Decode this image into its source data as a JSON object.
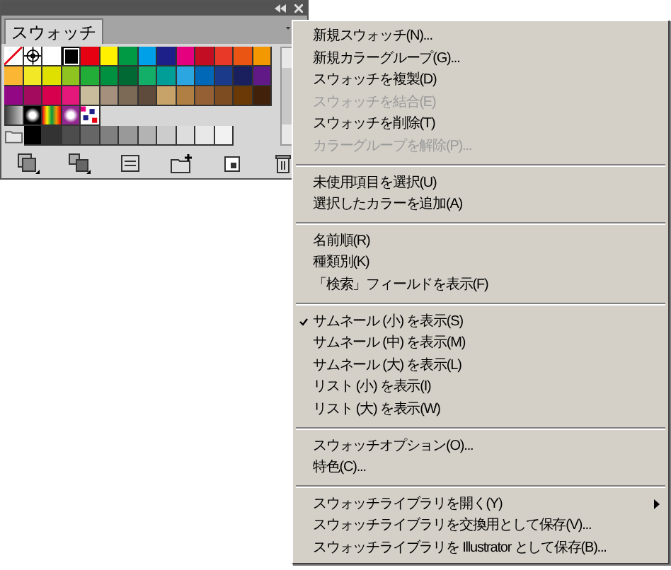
{
  "panel": {
    "tab": {
      "label": "スウォッチ",
      "selected": true
    },
    "swatch_rows": [
      [
        {
          "kind": "none"
        },
        {
          "kind": "registration"
        },
        {
          "kind": "solid",
          "color": "#ffffff"
        },
        {
          "kind": "solid",
          "color": "#000000",
          "selected": true
        },
        {
          "kind": "solid",
          "color": "#e60012"
        },
        {
          "kind": "solid",
          "color": "#fff100"
        },
        {
          "kind": "solid",
          "color": "#009944"
        },
        {
          "kind": "solid",
          "color": "#00a0e9"
        },
        {
          "kind": "solid",
          "color": "#1d2088"
        },
        {
          "kind": "solid",
          "color": "#e4007f"
        },
        {
          "kind": "solid",
          "color": "#c30d23"
        },
        {
          "kind": "solid",
          "color": "#e83828"
        },
        {
          "kind": "solid",
          "color": "#ea5514"
        },
        {
          "kind": "solid",
          "color": "#f39800"
        }
      ],
      [
        {
          "kind": "solid",
          "color": "#fbb634"
        },
        {
          "kind": "solid",
          "color": "#f3e826"
        },
        {
          "kind": "solid",
          "color": "#dfe000"
        },
        {
          "kind": "solid",
          "color": "#8fc31f"
        },
        {
          "kind": "solid",
          "color": "#22ac38"
        },
        {
          "kind": "solid",
          "color": "#009140"
        },
        {
          "kind": "solid",
          "color": "#006934"
        },
        {
          "kind": "solid",
          "color": "#13ae67"
        },
        {
          "kind": "solid",
          "color": "#009e96"
        },
        {
          "kind": "solid",
          "color": "#2ca6e0"
        },
        {
          "kind": "solid",
          "color": "#0068b7"
        },
        {
          "kind": "solid",
          "color": "#1b3a8a"
        },
        {
          "kind": "solid",
          "color": "#1a1f5d"
        },
        {
          "kind": "solid",
          "color": "#601986"
        }
      ],
      [
        {
          "kind": "solid",
          "color": "#920783"
        },
        {
          "kind": "solid",
          "color": "#a20b5e"
        },
        {
          "kind": "solid",
          "color": "#d7004f"
        },
        {
          "kind": "solid",
          "color": "#e4187b"
        },
        {
          "kind": "solid",
          "color": "#c9bc9c"
        },
        {
          "kind": "solid",
          "color": "#a4907c"
        },
        {
          "kind": "solid",
          "color": "#7c6a56"
        },
        {
          "kind": "solid",
          "color": "#5e4b3c"
        },
        {
          "kind": "solid",
          "color": "#c7a269"
        },
        {
          "kind": "solid",
          "color": "#b07f44"
        },
        {
          "kind": "solid",
          "color": "#956134"
        },
        {
          "kind": "solid",
          "color": "#7e4c21"
        },
        {
          "kind": "solid",
          "color": "#6a3906"
        },
        {
          "kind": "solid",
          "color": "#42210b"
        }
      ],
      [
        {
          "kind": "fade"
        },
        {
          "kind": "radial",
          "color": "#000000"
        },
        {
          "kind": "spectrum"
        },
        {
          "kind": "radial",
          "color": "#92278f"
        },
        {
          "kind": "pattern"
        }
      ],
      [
        {
          "kind": "folder"
        },
        {
          "kind": "solid",
          "color": "#000000"
        },
        {
          "kind": "solid",
          "color": "#333333"
        },
        {
          "kind": "solid",
          "color": "#4d4d4d"
        },
        {
          "kind": "solid",
          "color": "#666666"
        },
        {
          "kind": "solid",
          "color": "#808080"
        },
        {
          "kind": "solid",
          "color": "#999999"
        },
        {
          "kind": "solid",
          "color": "#b3b3b3"
        },
        {
          "kind": "solid",
          "color": "#cccccc"
        },
        {
          "kind": "solid",
          "color": "#dddddd"
        },
        {
          "kind": "solid",
          "color": "#e8e8e8"
        },
        {
          "kind": "solid",
          "color": "#f2f2f2"
        }
      ]
    ]
  },
  "menu": [
    {
      "kind": "item",
      "label": "新規スウォッチ(N)...",
      "disabled": false
    },
    {
      "kind": "item",
      "label": "新規カラーグループ(G)...",
      "disabled": false
    },
    {
      "kind": "item",
      "label": "スウォッチを複製(D)",
      "disabled": false
    },
    {
      "kind": "item",
      "label": "スウォッチを結合(E)",
      "disabled": true
    },
    {
      "kind": "item",
      "label": "スウォッチを削除(T)",
      "disabled": false
    },
    {
      "kind": "item",
      "label": "カラーグループを解除(P)...",
      "disabled": true
    },
    {
      "kind": "separator"
    },
    {
      "kind": "item",
      "label": "未使用項目を選択(U)",
      "disabled": false
    },
    {
      "kind": "item",
      "label": "選択したカラーを追加(A)",
      "disabled": false
    },
    {
      "kind": "separator"
    },
    {
      "kind": "item",
      "label": "名前順(R)",
      "disabled": false
    },
    {
      "kind": "item",
      "label": "種類別(K)",
      "disabled": false
    },
    {
      "kind": "item",
      "label": "「検索」フィールドを表示(F)",
      "disabled": false
    },
    {
      "kind": "separator"
    },
    {
      "kind": "item",
      "label": "サムネール (小) を表示(S)",
      "disabled": false,
      "checked": true
    },
    {
      "kind": "item",
      "label": "サムネール (中) を表示(M)",
      "disabled": false,
      "checked": false
    },
    {
      "kind": "item",
      "label": "サムネール (大) を表示(L)",
      "disabled": false,
      "checked": false
    },
    {
      "kind": "item",
      "label": "リスト (小) を表示(I)",
      "disabled": false,
      "checked": false
    },
    {
      "kind": "item",
      "label": "リスト (大) を表示(W)",
      "disabled": false,
      "checked": false
    },
    {
      "kind": "separator"
    },
    {
      "kind": "item",
      "label": "スウォッチオプション(O)...",
      "disabled": false
    },
    {
      "kind": "item",
      "label": "特色(C)...",
      "disabled": false
    },
    {
      "kind": "separator"
    },
    {
      "kind": "item",
      "label": "スウォッチライブラリを開く(Y)",
      "disabled": false,
      "submenu": true
    },
    {
      "kind": "item",
      "label": "スウォッチライブラリを交換用として保存(V)...",
      "disabled": false
    },
    {
      "kind": "item",
      "label": "スウォッチライブラリを Illustrator として保存(B)...",
      "disabled": false
    }
  ]
}
